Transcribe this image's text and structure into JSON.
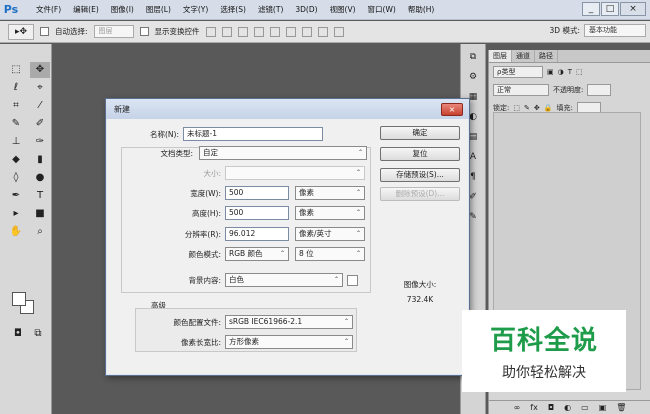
{
  "app": {
    "logo": "Ps"
  },
  "menu": [
    "文件(F)",
    "编辑(E)",
    "图像(I)",
    "图层(L)",
    "文字(Y)",
    "选择(S)",
    "滤镜(T)",
    "3D(D)",
    "视图(V)",
    "窗口(W)",
    "帮助(H)"
  ],
  "window_controls": {
    "minimize": "_",
    "maximize": "□",
    "close": "×"
  },
  "options_bar": {
    "auto_select_label": "自动选择:",
    "auto_select_value": "图层",
    "show_transform_label": "显示变换控件",
    "mode_3d_label": "3D 模式:",
    "workspace_value": "基本功能"
  },
  "layers_panel": {
    "tabs": [
      "图层",
      "通道",
      "路径"
    ],
    "kind_filter": "ρ类型",
    "blend_mode": "正常",
    "opacity_label": "不透明度:",
    "lock_label": "锁定:",
    "fill_label": "填充:"
  },
  "dialog": {
    "title": "新建",
    "close_label": "×",
    "name_label": "名称(N):",
    "name_value": "未标题-1",
    "preset_label": "文档类型:",
    "preset_value": "自定",
    "size_label": "大小:",
    "width_label": "宽度(W):",
    "width_value": "500",
    "width_unit": "像素",
    "height_label": "高度(H):",
    "height_value": "500",
    "height_unit": "像素",
    "resolution_label": "分辨率(R):",
    "resolution_value": "96.012",
    "resolution_unit": "像素/英寸",
    "color_mode_label": "颜色模式:",
    "color_mode_value": "RGB 颜色",
    "bit_depth_value": "8 位",
    "background_label": "背景内容:",
    "background_value": "白色",
    "advanced_label": "高级",
    "color_profile_label": "颜色配置文件:",
    "color_profile_value": "sRGB IEC61966-2.1",
    "pixel_aspect_label": "像素长宽比:",
    "pixel_aspect_value": "方形像素",
    "ok_label": "确定",
    "reset_label": "复位",
    "save_preset_label": "存储预设(S)...",
    "delete_preset_label": "删除预设(D)...",
    "image_size_label": "图像大小:",
    "image_size_value": "732.4K"
  },
  "watermark": {
    "title": "百科全说",
    "subtitle": "助你轻松解决"
  }
}
